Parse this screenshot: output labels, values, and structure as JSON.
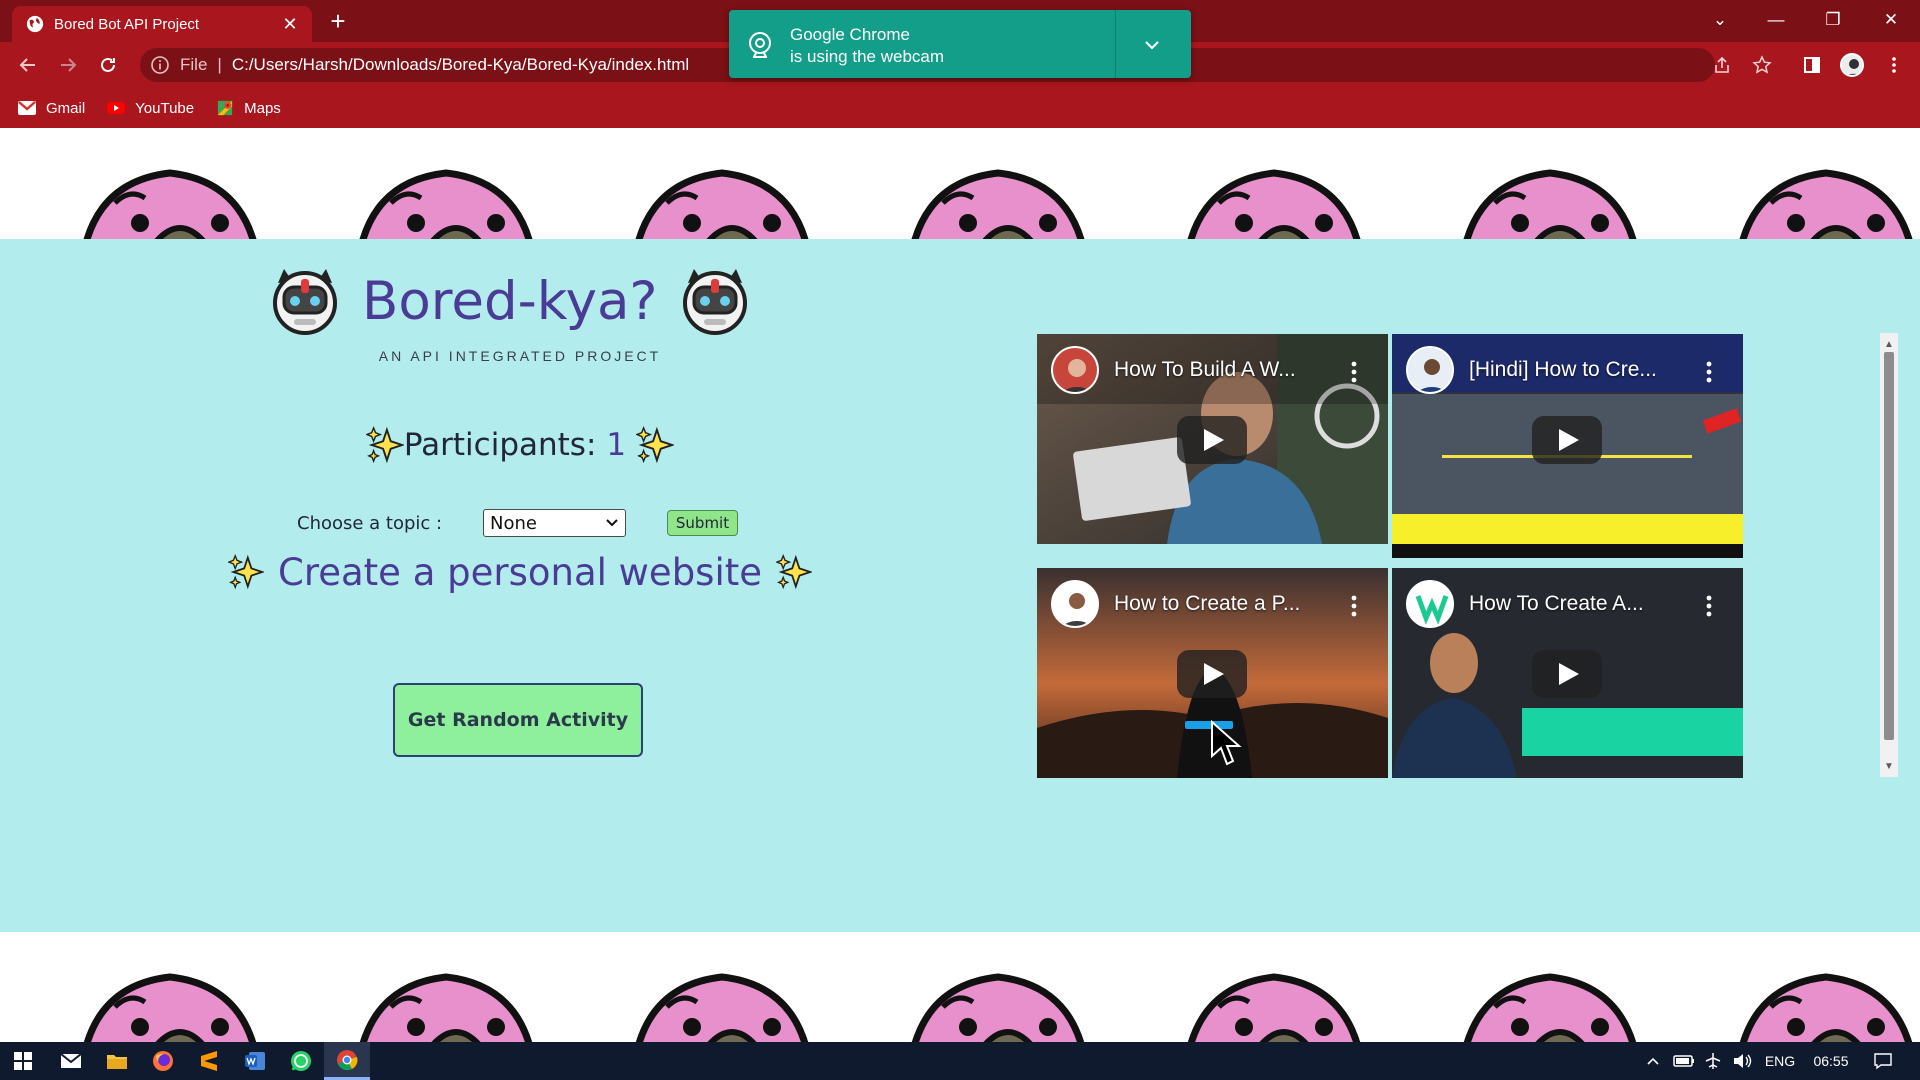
{
  "browser": {
    "tab_title": "Bored Bot API Project",
    "tab_close": "✕",
    "new_tab": "+",
    "window_controls": {
      "tab_search": "⌄",
      "minimize": "—",
      "restore": "❐",
      "close": "✕"
    },
    "address_scheme": "File",
    "address_url": "C:/Users/Harsh/Downloads/Bored-Kya/Bored-Kya/index.html",
    "bookmarks": [
      {
        "label": "Gmail",
        "icon": "gmail-icon"
      },
      {
        "label": "YouTube",
        "icon": "youtube-icon"
      },
      {
        "label": "Maps",
        "icon": "maps-icon"
      }
    ],
    "notification": {
      "line1": "Google Chrome",
      "line2": "is using the webcam"
    }
  },
  "page": {
    "title": "Bored-kya?",
    "subtitle": "AN API INTEGRATED PROJECT",
    "participants_label": "Participants:",
    "participants_value": "1",
    "topic_label": "Choose a topic :",
    "topic_selected": "None",
    "submit_label": "Submit",
    "activity": "Create a personal website",
    "random_button": "Get Random Activity",
    "videos": [
      {
        "title": "How To Build A W..."
      },
      {
        "title": "[Hindi] How to Cre..."
      },
      {
        "title": "How to Create a P..."
      },
      {
        "title": "How To Create A..."
      }
    ]
  },
  "taskbar": {
    "language": "ENG",
    "time": "06:55"
  },
  "colors": {
    "chrome_dark": "#7b1016",
    "chrome": "#a9161d",
    "page_bg": "#b2eced",
    "accent_text": "#4a3b95",
    "button_green": "#8ef09c",
    "notification": "#139e8a"
  }
}
